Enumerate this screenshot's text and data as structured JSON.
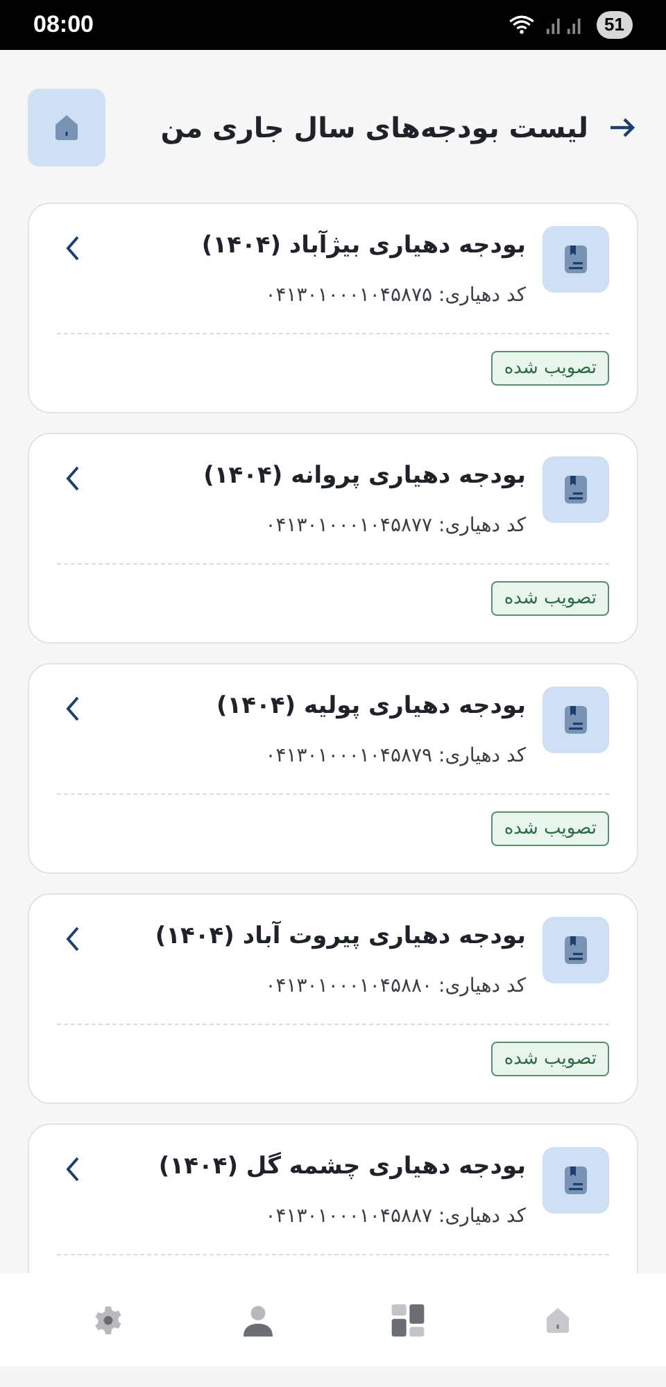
{
  "status_bar": {
    "time": "08:00",
    "battery": "51"
  },
  "header": {
    "title": "لیست بودجه‌های سال جاری من"
  },
  "budgets": [
    {
      "title": "بودجه دهیاری بیژآباد (۱۴۰۴)",
      "code": "کد دهیاری: ۰۴۱۳۰۱۰۰۰۱۰۴۵۸۷۵",
      "status": "تصویب شده"
    },
    {
      "title": "بودجه دهیاری پروانه (۱۴۰۴)",
      "code": "کد دهیاری: ۰۴۱۳۰۱۰۰۰۱۰۴۵۸۷۷",
      "status": "تصویب شده"
    },
    {
      "title": "بودجه دهیاری پولیه (۱۴۰۴)",
      "code": "کد دهیاری: ۰۴۱۳۰۱۰۰۰۱۰۴۵۸۷۹",
      "status": "تصویب شده"
    },
    {
      "title": "بودجه دهیاری پیروت آباد (۱۴۰۴)",
      "code": "کد دهیاری: ۰۴۱۳۰۱۰۰۰۱۰۴۵۸۸۰",
      "status": "تصویب شده"
    },
    {
      "title": "بودجه دهیاری چشمه گل (۱۴۰۴)",
      "code": "کد دهیاری: ۰۴۱۳۰۱۰۰۰۱۰۴۵۸۸۷"
    }
  ],
  "bottom_nav": [
    {
      "kind": "settings"
    },
    {
      "kind": "profile"
    },
    {
      "kind": "dashboard"
    },
    {
      "kind": "home"
    }
  ]
}
